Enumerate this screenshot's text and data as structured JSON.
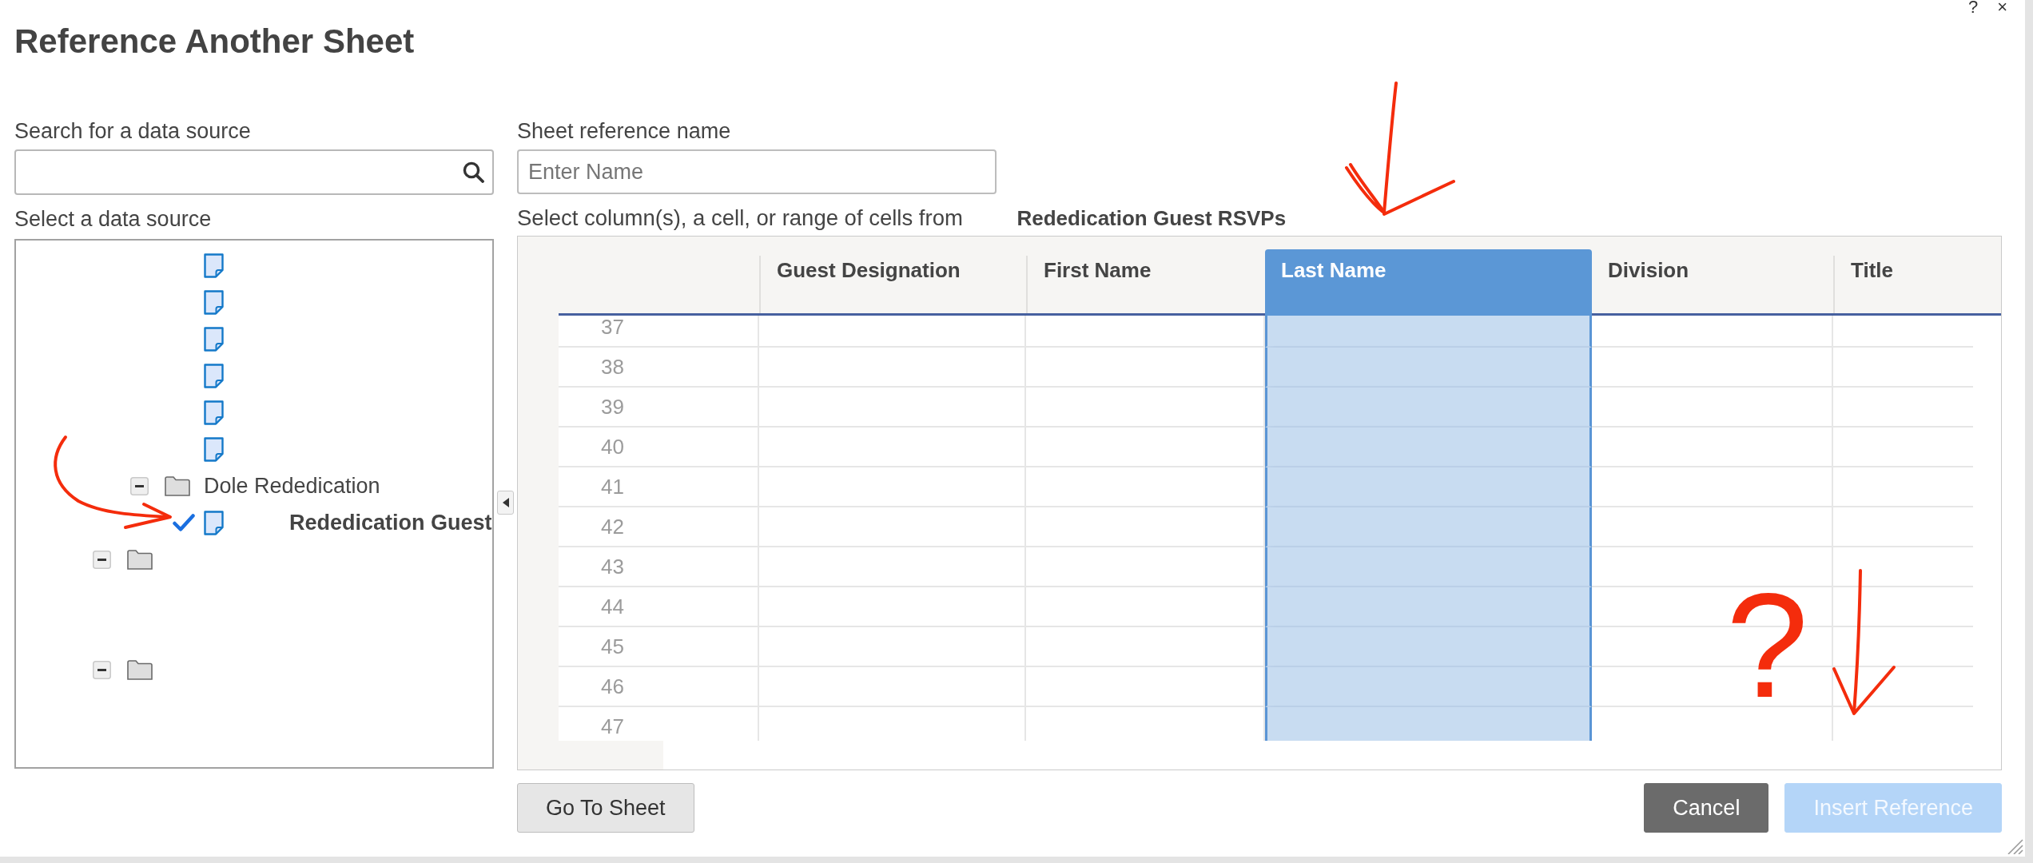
{
  "dialog": {
    "title": "Reference Another Sheet",
    "help": "?",
    "close": "×"
  },
  "source_search": {
    "label": "Search for a data source"
  },
  "source_tree": {
    "label": "Select a data source",
    "items": [
      {
        "kind": "offscreen",
        "children": [
          {
            "kind": "offscreen",
            "children": [
              {
                "kind": "file",
                "checked": false
              },
              {
                "kind": "file",
                "checked": false
              },
              {
                "kind": "file",
                "checked": false
              },
              {
                "kind": "file",
                "checked": false
              },
              {
                "kind": "file",
                "checked": false
              },
              {
                "kind": "file",
                "checked": false
              }
            ]
          },
          {
            "kind": "folder",
            "label": "Dole Rededication",
            "expanded": true,
            "children": [
              {
                "kind": "file",
                "label": "Rededication Guest",
                "checked": true
              }
            ]
          }
        ]
      },
      {
        "kind": "folder",
        "expanded": true
      },
      {
        "kind": "folder",
        "expanded": true
      }
    ]
  },
  "reference_name": {
    "label": "Sheet reference name",
    "placeholder": "Enter Name"
  },
  "range_prompt": "Select column(s), a cell, or range of cells from **Rededication Guest RSVPs**",
  "sheet_grid": {
    "columns": [
      {
        "label": "Guest Designation",
        "selected": false
      },
      {
        "label": "First Name",
        "selected": false
      },
      {
        "label": "Last Name",
        "selected": true
      },
      {
        "label": "Division",
        "selected": false
      },
      {
        "label": "Title",
        "selected": false
      }
    ],
    "rows": [
      {
        "number": "37"
      },
      {
        "number": "38"
      },
      {
        "number": "39"
      },
      {
        "number": "40"
      },
      {
        "number": "41"
      },
      {
        "number": "42"
      },
      {
        "number": "43"
      },
      {
        "number": "44"
      },
      {
        "number": "45"
      },
      {
        "number": "46"
      },
      {
        "number": "47"
      }
    ]
  },
  "buttons": [
    {
      "kind": "secondary",
      "label": "Go To Sheet",
      "disabled": false
    },
    {
      "kind": "neutral",
      "label": "Cancel",
      "disabled": false
    },
    {
      "kind": "primary",
      "label": "Insert Reference",
      "disabled": true
    }
  ],
  "annotations": [
    {
      "kind": "hooked-arrow"
    },
    {
      "kind": "curved-arrow"
    },
    {
      "kind": "straight-arrow"
    },
    {
      "kind": "question-mark",
      "text": "?"
    }
  ]
}
